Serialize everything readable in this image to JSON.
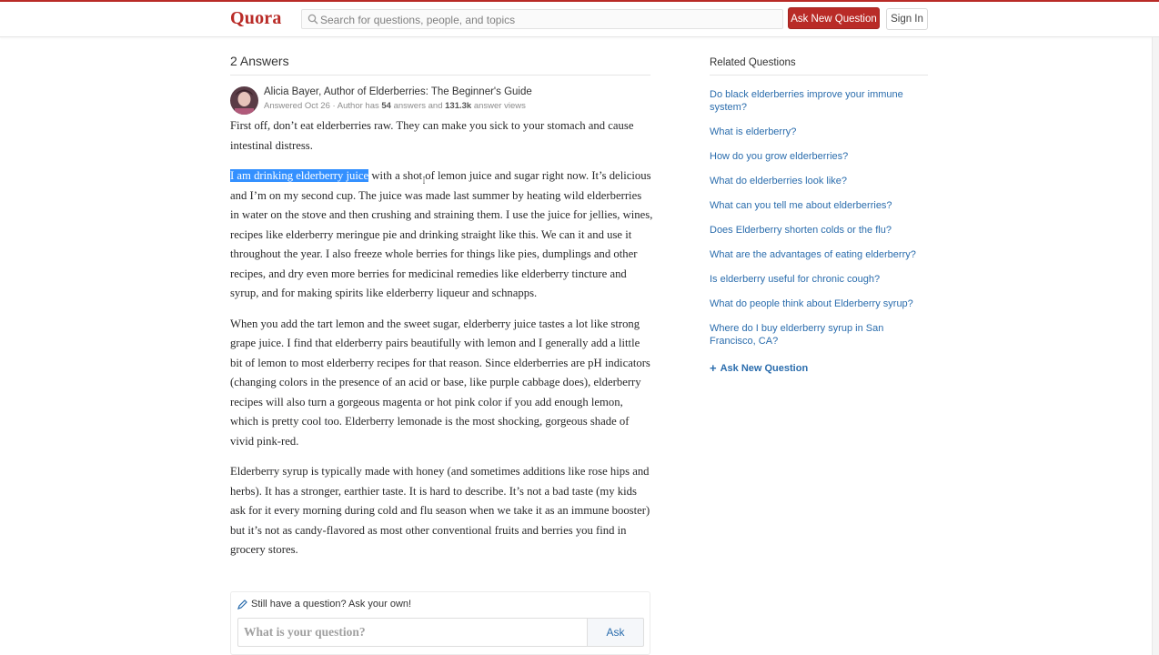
{
  "header": {
    "logo": "Quora",
    "search_placeholder": "Search for questions, people, and topics",
    "ask_button": "Ask New Question",
    "signin_button": "Sign In"
  },
  "answers": {
    "count_label": "2 Answers"
  },
  "answer": {
    "author": "Alicia Bayer, Author of Elderberries: The Beginner's Guide",
    "answered": "Answered Oct 26",
    "meta_prefix": "Author has",
    "answers_count": "54",
    "meta_mid": "answers and",
    "views": "131.3k",
    "meta_suffix": "answer views",
    "p1": "First off, don’t eat elderberries raw. They can make you sick to your stomach and cause intestinal distress.",
    "p2_highlight": "I am drinking elderberry juice",
    "p2_rest": " with a shot of lemon juice and sugar right now. It’s delicious and I’m on my second cup. The juice was made last summer by heating wild elderberries in water on the stove and then crushing and straining them. I use the juice for jellies, wines, recipes like elderberry meringue pie and drinking straight like this. We can it and use it throughout the year. I also freeze whole berries for things like pies, dumplings and other recipes, and dry even more berries for medicinal remedies like elderberry tincture and syrup, and for making spirits like elderberry liqueur and schnapps.",
    "p3": "When you add the tart lemon and the sweet sugar, elderberry juice tastes a lot like strong grape juice. I find that elderberry pairs beautifully with lemon and I generally add a little bit of lemon to most elderberry recipes for that reason. Since elderberries are pH indicators (changing colors in the presence of an acid or base, like purple cabbage does), elderberry recipes will also turn a gorgeous magenta or hot pink color if you add enough lemon, which is pretty cool too. Elderberry lemonade is the most shocking, gorgeous shade of vivid pink-red.",
    "p4": "Elderberry syrup is typically made with honey (and sometimes additions like rose hips and herbs). It has a stronger, earthier taste. It is hard to describe. It’s not a bad taste (my kids ask for it every morning during cold and flu season when we take it as an immune booster) but it’s not as candy-flavored as most other conventional fruits and berries you find in grocery stores."
  },
  "ask_box": {
    "title": "Still have a question? Ask your own!",
    "placeholder": "What is your question?",
    "button": "Ask"
  },
  "related": {
    "title": "Related Questions",
    "items": [
      "Do black elderberries improve your immune system?",
      "What is elderberry?",
      "How do you grow elderberries?",
      "What do elderberries look like?",
      "What can you tell me about elderberries?",
      "Does Elderberry shorten colds or the flu?",
      "What are the advantages of eating elderberry?",
      "Is elderberry useful for chronic cough?",
      "What do people think about Elderberry syrup?",
      "Where do I buy elderberry syrup in San Francisco, CA?"
    ],
    "ask_link": "Ask New Question"
  },
  "colors": {
    "brand": "#b92b27",
    "link": "#2b6dad",
    "selection": "#3390ff"
  },
  "icons": {
    "search": "magnifier",
    "pencil": "pencil",
    "plus": "plus",
    "cursor": "text-cursor"
  }
}
